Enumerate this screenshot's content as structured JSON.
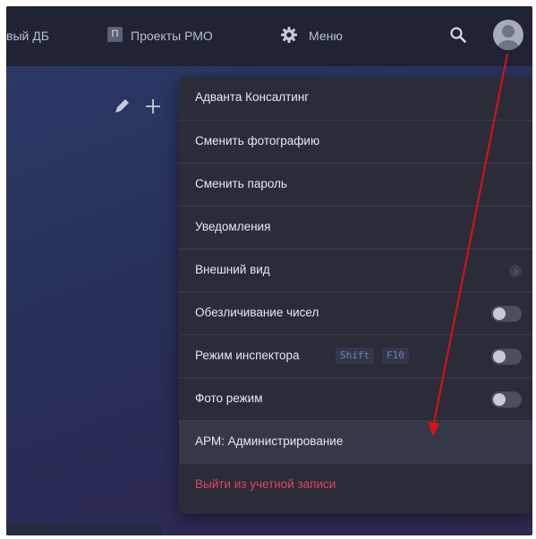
{
  "topbar": {
    "item_partial_label": "вый ДБ",
    "projects_icon_letter": "П",
    "projects_label": "Проекты РМО",
    "menu_label": "Меню"
  },
  "user_menu": {
    "items": [
      {
        "label": "Адванта Консалтинг"
      },
      {
        "label": "Сменить фотографию"
      },
      {
        "label": "Сменить пароль"
      },
      {
        "label": "Уведомления"
      },
      {
        "label": "Внешний вид"
      },
      {
        "label": "Обезличивание чисел",
        "toggle": false
      },
      {
        "label": "Режим инспектора",
        "shortcut": [
          "Shift",
          "F10"
        ],
        "toggle": false
      },
      {
        "label": "Фото режим",
        "toggle": false
      },
      {
        "label": "АРМ: Администрирование"
      },
      {
        "label": "Выйти из учетной записи"
      }
    ]
  },
  "colors": {
    "danger": "#e2445a",
    "annotation_arrow": "#e01010",
    "shortcut": "#6e84b8"
  }
}
